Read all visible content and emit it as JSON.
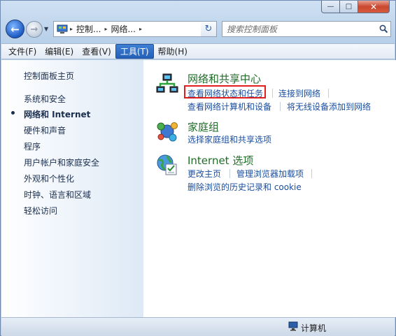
{
  "window": {
    "caption_min": "—",
    "caption_max": "□",
    "caption_close": "✕"
  },
  "nav": {
    "back_glyph": "←",
    "forward_glyph": "→",
    "recent_glyph": "▼",
    "go_glyph": "↻"
  },
  "address": {
    "segments": [
      "控制...",
      "网络..."
    ],
    "separator": "▸",
    "dropdown_glyph": "▼"
  },
  "search": {
    "placeholder": "搜索控制面板"
  },
  "menu": {
    "items": [
      "文件(F)",
      "编辑(E)",
      "查看(V)",
      "工具(T)",
      "帮助(H)"
    ],
    "active_index": 3
  },
  "sidebar": {
    "items": [
      "控制面板主页",
      "系统和安全",
      "网络和 Internet",
      "硬件和声音",
      "程序",
      "用户帐户和家庭安全",
      "外观和个性化",
      "时钟、语言和区域",
      "轻松访问"
    ],
    "current_index": 2
  },
  "categories": [
    {
      "title": "网络和共享中心",
      "icon": "network-icon",
      "links": [
        "查看网络状态和任务",
        "连接到网络",
        "查看网络计算机和设备",
        "将无线设备添加到网络"
      ]
    },
    {
      "title": "家庭组",
      "icon": "homegroup-icon",
      "links": [
        "选择家庭组和共享选项"
      ]
    },
    {
      "title": "Internet 选项",
      "icon": "internet-options-icon",
      "links": [
        "更改主页",
        "管理浏览器加载项",
        "删除浏览的历史记录和 cookie"
      ]
    }
  ],
  "statusbar": {
    "text": "计算机"
  },
  "colors": {
    "link": "#1b4ea0",
    "category_title": "#1f6d27",
    "highlight": "#e11d1d",
    "menu_active": "#2460b8"
  }
}
